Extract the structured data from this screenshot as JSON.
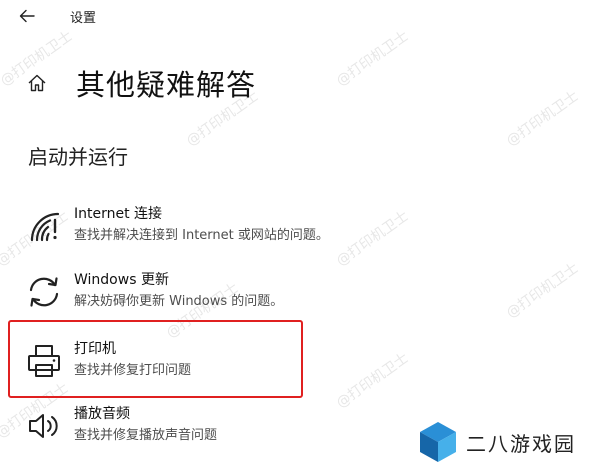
{
  "app": {
    "title": "设置"
  },
  "header": {
    "title": "其他疑难解答"
  },
  "section": {
    "title": "启动并运行"
  },
  "items": [
    {
      "name": "Internet 连接",
      "desc": "查找并解决连接到 Internet 或网站的问题。",
      "icon": "wifi-warning-icon"
    },
    {
      "name": "Windows 更新",
      "desc": "解决妨碍你更新 Windows 的问题。",
      "icon": "refresh-icon"
    },
    {
      "name": "打印机",
      "desc": "查找并修复打印问题",
      "icon": "printer-icon"
    },
    {
      "name": "播放音频",
      "desc": "查找并修复播放声音问题",
      "icon": "speaker-icon"
    }
  ],
  "highlight": {
    "color": "#e02020"
  },
  "watermark": {
    "text": "@打印机卫士"
  },
  "logo": {
    "text": "二八游戏园"
  }
}
